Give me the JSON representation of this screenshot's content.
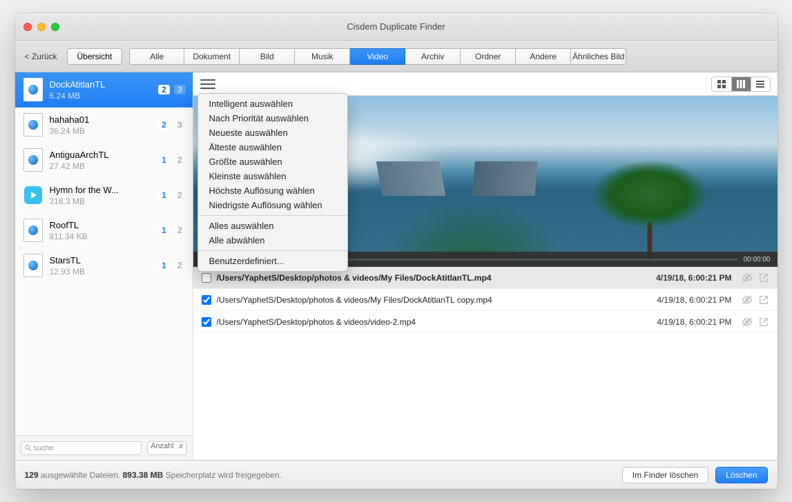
{
  "window": {
    "title": "Cisdem Duplicate Finder",
    "back": "< Zurück"
  },
  "tabs": {
    "overview": "Übersicht",
    "items": [
      "Alle",
      "Dokument",
      "Bild",
      "Musik",
      "Video",
      "Archiv",
      "Ordner",
      "Andere",
      "Ähnliches Bild"
    ],
    "active_index": 4
  },
  "sidebar": {
    "items": [
      {
        "name": "DockAtitlanTL",
        "size": "6.24 MB",
        "sel": "2",
        "total": "3",
        "icon": "video",
        "selected": true
      },
      {
        "name": "hahaha01",
        "size": "36.24 MB",
        "sel": "2",
        "total": "3",
        "icon": "video",
        "selected": false
      },
      {
        "name": "AntiguaArchTL",
        "size": "27.42 MB",
        "sel": "1",
        "total": "2",
        "icon": "video",
        "selected": false
      },
      {
        "name": "Hymn for the W...",
        "size": "316.3 MB",
        "sel": "1",
        "total": "2",
        "icon": "play",
        "selected": false
      },
      {
        "name": "RoofTL",
        "size": "811.34 KB",
        "sel": "1",
        "total": "2",
        "icon": "video",
        "selected": false
      },
      {
        "name": "StarsTL",
        "size": "12.93 MB",
        "sel": "1",
        "total": "2",
        "icon": "video",
        "selected": false
      }
    ],
    "search_placeholder": "suche",
    "sort_label": "Anzahl"
  },
  "menu": {
    "groups": [
      [
        "Intelligent auswählen",
        "Nach Priorität auswählen",
        "Neueste auswählen",
        "Älteste auswählen",
        "Größte auswählen",
        "Kleinste auswählen",
        "Höchste Auflösung wählen",
        "Niedrigste Auflösung wählen"
      ],
      [
        "Alles auswählen",
        "Alle abwählen"
      ],
      [
        "Benutzerdefiniert..."
      ]
    ]
  },
  "preview": {
    "time": "00:00:00"
  },
  "duplicates": {
    "rows": [
      {
        "checked": false,
        "path": "/Users/YaphetS/Desktop/photos & videos/My Files/DockAtitlanTL.mp4",
        "date": "4/19/18, 6:00:21 PM",
        "header": true
      },
      {
        "checked": true,
        "path": "/Users/YaphetS/Desktop/photos & videos/My Files/DockAtitlanTL copy.mp4",
        "date": "4/19/18, 6:00:21 PM",
        "header": false
      },
      {
        "checked": true,
        "path": "/Users/YaphetS/Desktop/photos & videos/video-2.mp4",
        "date": "4/19/18, 6:00:21 PM",
        "header": false
      }
    ]
  },
  "footer": {
    "count": "129",
    "text1": " ausgewählte Dateien. ",
    "size": "893.38 MB",
    "text2": " Speicherplatz wird freigegeben.",
    "finder_btn": "Im Finder löschen",
    "delete_btn": "Löschen"
  }
}
